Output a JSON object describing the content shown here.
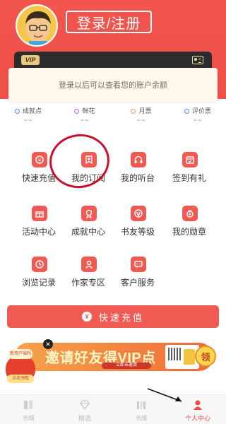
{
  "header": {
    "login_label": "登录/注册",
    "vip_badge": "VIP",
    "balance_hint": "登录以后可以查看您的账户余额"
  },
  "stats": [
    {
      "label": "成就点",
      "value": "~~",
      "color": "#5b8de0"
    },
    {
      "label": "鲜花",
      "value": "~~",
      "color": "#b36fd8"
    },
    {
      "label": "月票",
      "value": "~~",
      "color": "#f2a14b"
    },
    {
      "label": "评价票",
      "value": "~~",
      "color": "#5b8de0"
    }
  ],
  "grid": [
    {
      "label": "快速充值",
      "icon": "recharge-icon"
    },
    {
      "label": "我的订阅",
      "icon": "subscription-icon"
    },
    {
      "label": "我的听台",
      "icon": "headphones-icon"
    },
    {
      "label": "签到有礼",
      "icon": "calendar-icon"
    },
    {
      "label": "活动中心",
      "icon": "gift-icon"
    },
    {
      "label": "成就中心",
      "icon": "medal-icon"
    },
    {
      "label": "书友等级",
      "icon": "level-icon"
    },
    {
      "label": "我的勋章",
      "icon": "badge-icon"
    },
    {
      "label": "浏览记录",
      "icon": "history-icon"
    },
    {
      "label": "作家专区",
      "icon": "author-icon"
    },
    {
      "label": "客户服务",
      "icon": "service-icon"
    }
  ],
  "charge_button": {
    "label": "快速充值",
    "coin": "¥"
  },
  "banner": {
    "text": "邀请好友得VIP点",
    "sub": "立即去邀请",
    "claim": "领",
    "bag_top": "新用户福利",
    "bag_button": "点击领取"
  },
  "nav": [
    {
      "label": "书城",
      "active": false
    },
    {
      "label": "精选",
      "active": false
    },
    {
      "label": "书库",
      "active": false
    },
    {
      "label": "个人中心",
      "active": true
    }
  ],
  "colors": {
    "brand_red": "#f15a52",
    "icon_red": "#f15a52"
  }
}
